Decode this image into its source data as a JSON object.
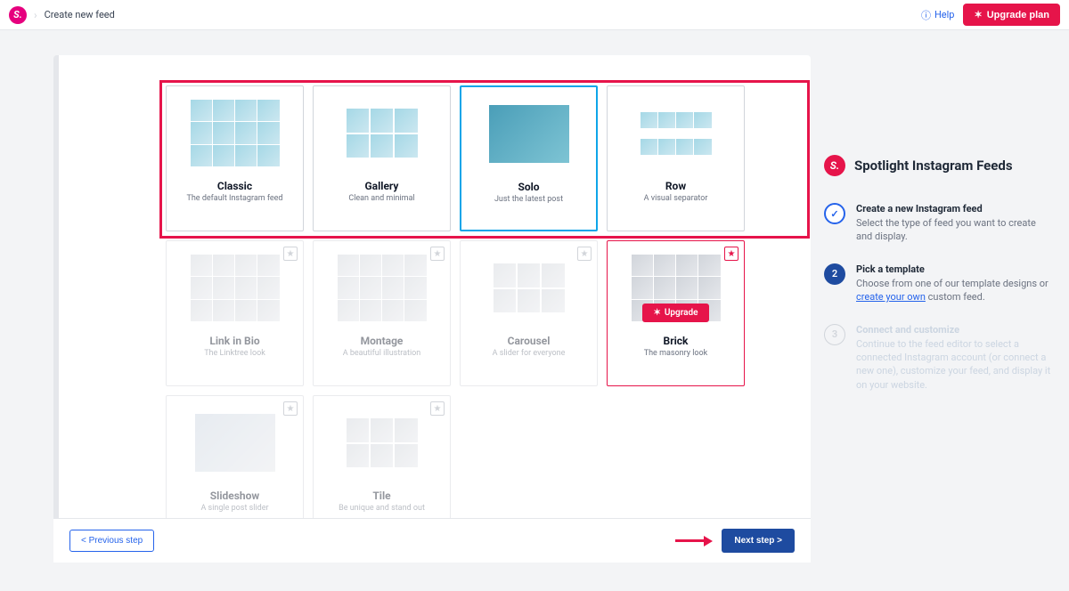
{
  "header": {
    "breadcrumb": "Create new feed",
    "help": "Help",
    "upgrade": "Upgrade plan"
  },
  "templates": [
    {
      "title": "Classic",
      "subtitle": "The default Instagram feed",
      "state": "normal",
      "preview": "grid4",
      "star": null
    },
    {
      "title": "Gallery",
      "subtitle": "Clean and minimal",
      "state": "normal",
      "preview": "grid3",
      "star": null
    },
    {
      "title": "Solo",
      "subtitle": "Just the latest post",
      "state": "selected",
      "preview": "solo",
      "star": null
    },
    {
      "title": "Row",
      "subtitle": "A visual separator",
      "state": "normal",
      "preview": "rows",
      "star": null
    },
    {
      "title": "Link in Bio",
      "subtitle": "The Linktree look",
      "state": "faded",
      "preview": "grid4g",
      "star": "normal"
    },
    {
      "title": "Montage",
      "subtitle": "A beautiful illustration",
      "state": "faded",
      "preview": "grid4g",
      "star": "normal"
    },
    {
      "title": "Carousel",
      "subtitle": "A slider for everyone",
      "state": "faded",
      "preview": "grid3g",
      "star": "normal"
    },
    {
      "title": "Brick",
      "subtitle": "The masonry look",
      "state": "highlight",
      "preview": "grid4g",
      "star": "active",
      "upgrade": "Upgrade"
    },
    {
      "title": "Slideshow",
      "subtitle": "A single post slider",
      "state": "faded",
      "preview": "solog",
      "star": "normal"
    },
    {
      "title": "Tile",
      "subtitle": "Be unique and stand out",
      "state": "faded",
      "preview": "grid3g",
      "star": "normal"
    }
  ],
  "footer": {
    "prev": "< Previous step",
    "next": "Next step >"
  },
  "sidebar": {
    "brand": "Spotlight Instagram Feeds",
    "steps": [
      {
        "title": "Create a new Instagram feed",
        "desc": "Select the type of feed you want to create and display."
      },
      {
        "title": "Pick a template",
        "desc_prefix": "Choose from one of our template designs or ",
        "link": "create your own",
        "desc_suffix": " custom feed."
      },
      {
        "title": "Connect and customize",
        "desc": "Continue to the feed editor to select a connected Instagram account (or connect a new one), customize your feed, and display it on your website."
      }
    ]
  }
}
